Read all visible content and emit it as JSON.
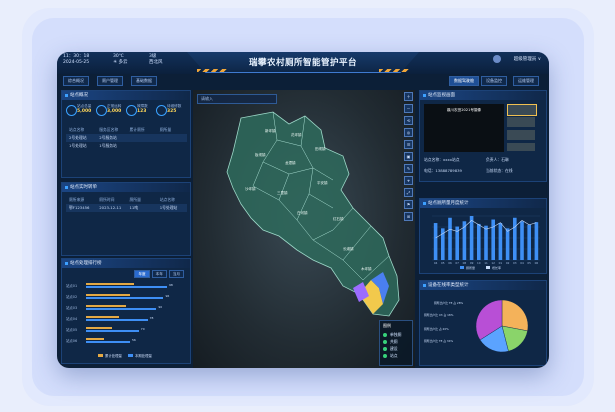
{
  "topbar": {
    "time": "11：30：18",
    "date": "2024-05-25",
    "temp": "30℃",
    "weather": "☀ 多云",
    "wind": "3级",
    "wind_dir": "西北风",
    "title": "瑞攀农村厕所智能管护平台",
    "user": "超级管理员"
  },
  "left_nav": [
    "综合概况",
    "厕户管理",
    "基础数据"
  ],
  "right_nav": [
    "数据驾驶舱",
    "设备监控",
    "运维管理"
  ],
  "overview": {
    "title": "站点概况",
    "stats": [
      {
        "label": "站点总量",
        "value": "5,000",
        "icon": "pin-icon"
      },
      {
        "label": "正常运转",
        "value": "3,000",
        "icon": "check-icon"
      },
      {
        "label": "故障数",
        "value": "123",
        "icon": "wrench-icon"
      },
      {
        "label": "待维修数",
        "value": "325",
        "icon": "clock-icon"
      }
    ],
    "table_head": [
      "站点名称",
      "服务区名称",
      "累计厕所",
      "厕所量"
    ],
    "rows": [
      [
        "2号处理站",
        "2号服务站",
        "",
        ""
      ],
      [
        "1号处理站",
        "1号服务站",
        "",
        ""
      ]
    ]
  },
  "realtime": {
    "title": "站点实时转单",
    "head": [
      "厕所来源",
      "厕所时间",
      "厕所量",
      "站点名称"
    ],
    "rows": [
      [
        "鄂F123456",
        "2023-12-11",
        "11吨",
        "1号处理站"
      ]
    ]
  },
  "ranking": {
    "title": "站点处理排行榜",
    "tabs": [
      "年度",
      "本年",
      "当月"
    ],
    "rows": [
      {
        "name": "站点01",
        "a": 0.55,
        "b": 0.92,
        "va": "",
        "vb": "98"
      },
      {
        "name": "站点02",
        "a": 0.5,
        "b": 0.88,
        "va": "",
        "vb": "96"
      },
      {
        "name": "站点03",
        "a": 0.45,
        "b": 0.8,
        "va": "",
        "vb": "90"
      },
      {
        "name": "站点04",
        "a": 0.38,
        "b": 0.7,
        "va": "",
        "vb": "78"
      },
      {
        "name": "站点05",
        "a": 0.3,
        "b": 0.6,
        "va": "",
        "vb": "70"
      },
      {
        "name": "站点06",
        "a": 0.2,
        "b": 0.5,
        "va": "",
        "vb": "56"
      }
    ],
    "legend": [
      "累计处理量",
      "本期处理量"
    ],
    "colors": [
      "#e4a944",
      "#3e8ff5"
    ]
  },
  "map": {
    "search_placeholder": "请输入",
    "tools": [
      "＋",
      "－",
      "⟲",
      "◎",
      "☰",
      "▣",
      "✎",
      "⌖",
      "⤢",
      "⚑",
      "⊞"
    ],
    "legend_title": "图例",
    "legend_items": [
      "单独厕",
      "共厕",
      "建设",
      "站点"
    ],
    "regions": [
      "新坪镇",
      "花坪镇",
      "田坝镇",
      "板坝镇",
      "龙潭镇",
      "平安镇",
      "沙坪镇",
      "三里镇",
      "白河镇",
      "红石镇",
      "长滩镇",
      "木坪镇"
    ]
  },
  "monitor": {
    "title": "站点监视画面",
    "video_caption": "鼎川农田2021号摄像",
    "site_label": "站点名称：",
    "site_value": "xxxx站点",
    "owner_label": "负责人：",
    "owner_value": "石琳",
    "phone_label": "电话：",
    "phone_value": "13888789839",
    "status_label": "当前状态：",
    "status_value": "在线"
  },
  "monthly": {
    "title": "站点厕所量月度统计",
    "legend": [
      "厕所量",
      "增长率"
    ]
  },
  "pie": {
    "title": "设备在线率类型统计",
    "labels": [
      "厕所比户比 TE 占 28%",
      "厕所比户比 X3 占 18%",
      "厕所比户比 占 20%",
      "厕所比户比 TE 占 34%"
    ]
  },
  "chart_data": [
    {
      "type": "bar",
      "title": "站点厕所量月度统计",
      "categories": [
        "04",
        "05",
        "06",
        "07",
        "08",
        "09",
        "10",
        "11",
        "12",
        "01",
        "02",
        "03",
        "04",
        "05",
        "06"
      ],
      "series": [
        {
          "name": "厕所量",
          "values": [
            210,
            180,
            240,
            190,
            220,
            250,
            205,
            195,
            230,
            210,
            180,
            240,
            220,
            200,
            215
          ]
        },
        {
          "name": "增长率",
          "values": [
            10,
            12,
            14,
            13,
            15,
            18,
            16,
            14,
            15,
            17,
            13,
            15,
            18,
            16,
            17
          ]
        }
      ],
      "colors": [
        "#3e8ff5",
        "#c9dbf7"
      ],
      "ylim": [
        0,
        250
      ]
    },
    {
      "type": "pie",
      "title": "设备在线率类型统计",
      "categories": [
        "TE",
        "X3",
        "其他",
        "TE2"
      ],
      "values": [
        28,
        18,
        20,
        34
      ],
      "colors": [
        "#f4b25a",
        "#8ad46a",
        "#5ba3ff",
        "#b84fd6"
      ]
    }
  ]
}
